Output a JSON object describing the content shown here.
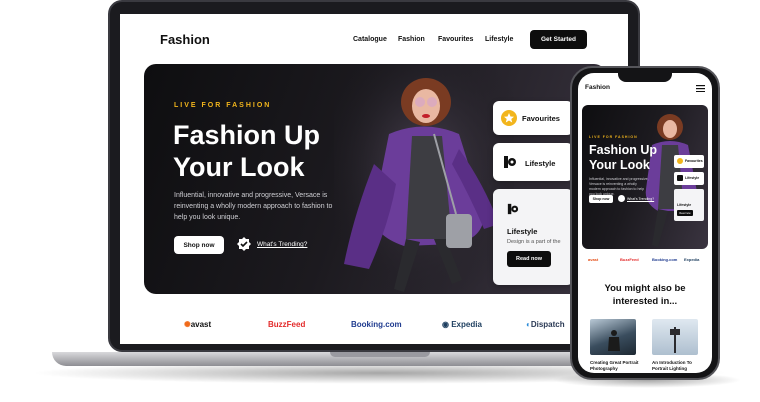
{
  "site": {
    "brand": "Fashion"
  },
  "nav": {
    "links": [
      "Catalogue",
      "Fashion",
      "Favourites",
      "Lifestyle"
    ],
    "cta": "Get Started"
  },
  "hero": {
    "eyebrow": "LIVE FOR FASHION",
    "title_line1": "Fashion Up",
    "title_line2": "Your Look",
    "description": "Influential, innovative and progressive, Versace is reinventing a wholly modern approach to fashion to help you look unique.",
    "shop_button": "Shop now",
    "trending_link": "What's Trending?"
  },
  "cards": {
    "favourites": "Favourites",
    "lifestyle": "Lifestyle",
    "feature_title": "Lifestyle",
    "feature_desc": "Design is a part of the",
    "feature_button": "Read now"
  },
  "partners": [
    "avast",
    "BuzzFeed",
    "Booking.com",
    "Expedia",
    "Dispatch"
  ],
  "mobile": {
    "brand": "Fashion",
    "section_title": "You might also be interested in...",
    "articles": [
      {
        "title": "Creating Great Portrait Photography"
      },
      {
        "title": "An Introduction To Portrait Lighting"
      }
    ]
  },
  "colors": {
    "accent": "#f2b51c",
    "dark": "#0d0d0d",
    "purple": "#6b3d9a"
  }
}
